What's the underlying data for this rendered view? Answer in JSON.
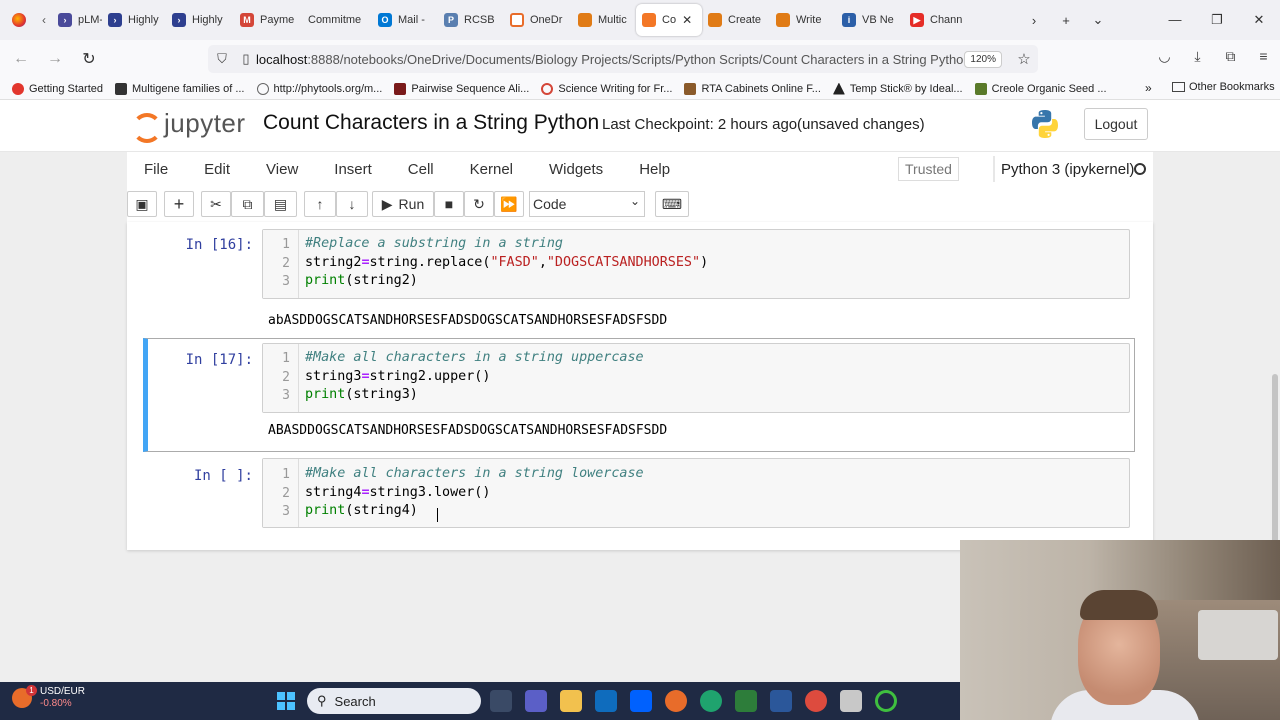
{
  "browser": {
    "tabs": [
      {
        "label": "pLM-E",
        "color": "#4a4a9a"
      },
      {
        "label": "Highly",
        "color": "#2e3f8f"
      },
      {
        "label": "Highly",
        "color": "#2e3f8f"
      },
      {
        "label": "Payme",
        "color": "#d44638"
      },
      {
        "label": "Commitme",
        "color": "#7a7a7a"
      },
      {
        "label": "Mail -",
        "color": "#0078d4"
      },
      {
        "label": "RCSB",
        "color": "#5a7fb0"
      },
      {
        "label": "OneDr",
        "color": "#e86c2a"
      },
      {
        "label": "Multic",
        "color": "#e07b16"
      },
      {
        "label": "Co",
        "color": "#f37726",
        "active": true
      },
      {
        "label": "Create",
        "color": "#e07b16"
      },
      {
        "label": "Write",
        "color": "#e07b16"
      },
      {
        "label": "VB Ne",
        "color": "#2c5fa8"
      },
      {
        "label": "Chann",
        "color": "#e52d27"
      }
    ],
    "url_host": "localhost",
    "url_path": ":8888/notebooks/OneDrive/Documents/Biology Projects/Scripts/Python Scripts/Count Characters in a String Python.ipynb",
    "zoom": "120%",
    "bookmarks": [
      {
        "label": "Getting Started",
        "color": "#e2362d"
      },
      {
        "label": "Multigene families of ...",
        "color": "#333333"
      },
      {
        "label": "http://phytools.org/m...",
        "color": "#666666"
      },
      {
        "label": "Pairwise Sequence Ali...",
        "color": "#7a1a1a"
      },
      {
        "label": "Science Writing for Fr...",
        "color": "#d44638"
      },
      {
        "label": "RTA Cabinets Online F...",
        "color": "#8a5a2a"
      },
      {
        "label": "Temp Stick® by Ideal...",
        "color": "#222222"
      },
      {
        "label": "Creole Organic Seed ...",
        "color": "#5a7a2a"
      }
    ],
    "other_bookmarks": "Other Bookmarks"
  },
  "jupyter": {
    "logo_text": "jupyter",
    "notebook_title": "Count Characters in a String Python",
    "checkpoint": "Last Checkpoint: 2 hours ago",
    "unsaved": "(unsaved changes)",
    "logout": "Logout",
    "menu": [
      "File",
      "Edit",
      "View",
      "Insert",
      "Cell",
      "Kernel",
      "Widgets",
      "Help"
    ],
    "trusted": "Trusted",
    "kernel": "Python 3 (ipykernel)",
    "run_label": "Run",
    "cell_type": "Code"
  },
  "cells": [
    {
      "prompt": "In [16]:",
      "lines": [
        "1",
        "2",
        "3"
      ],
      "code": {
        "l1": "#Replace a substring in a string",
        "l2_var": "string2",
        "l2_eq": "=",
        "l2_call": "string.replace(",
        "l2_arg1": "\"FASD\"",
        "l2_comma": ",",
        "l2_arg2": "\"DOGSCATSANDHORSES\"",
        "l2_end": ")",
        "l3_fn": "print",
        "l3_rest": "(string2)"
      },
      "output": "abASDDOGSCATSANDHORSESFADSDOGSCATSANDHORSESFADSFSDD"
    },
    {
      "prompt": "In [17]:",
      "lines": [
        "1",
        "2",
        "3"
      ],
      "code": {
        "l1": "#Make all characters in a string uppercase",
        "l2_var": "string3",
        "l2_eq": "=",
        "l2_call": "string2.upper()",
        "l3_fn": "print",
        "l3_rest": "(string3)"
      },
      "output": "ABASDDOGSCATSANDHORSESFADSDOGSCATSANDHORSESFADSFSDD"
    },
    {
      "prompt": "In [ ]:",
      "lines": [
        "1",
        "2",
        "3"
      ],
      "code": {
        "l1": "#Make all characters in a string lowercase",
        "l2_var": "string4",
        "l2_eq": "=",
        "l2_call": "string3.lower()",
        "l3_fn": "print",
        "l3_rest": "(string4)"
      }
    }
  ],
  "taskbar": {
    "ticker_badge": "1",
    "ticker_name": "USD/EUR",
    "ticker_change": "-0.80%",
    "search": "Search"
  }
}
